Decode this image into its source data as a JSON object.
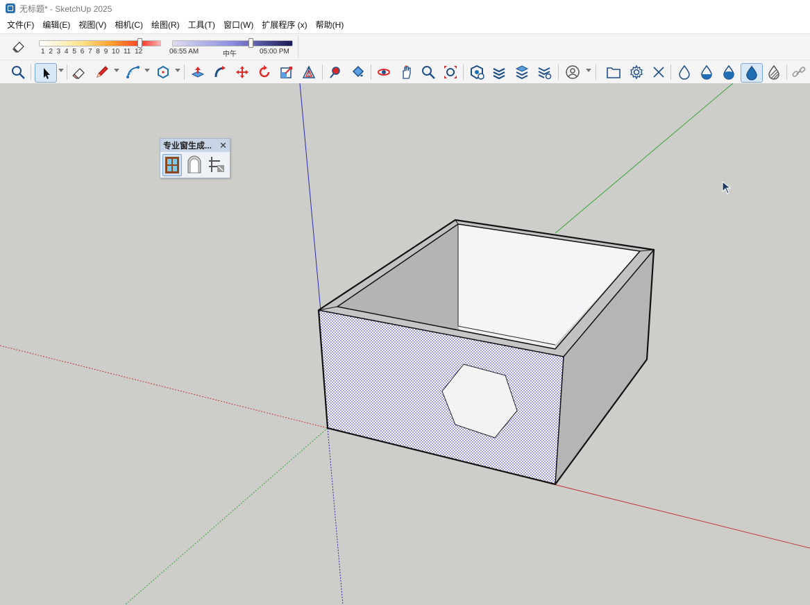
{
  "window": {
    "title": "无标题* - SketchUp 2025",
    "app_icon": "sketchup-logo-icon"
  },
  "menubar": {
    "items": [
      "文件(F)",
      "编辑(E)",
      "视图(V)",
      "相机(C)",
      "绘图(R)",
      "工具(T)",
      "窗口(W)",
      "扩展程序 (x)",
      "帮助(H)"
    ]
  },
  "shadow_toolbar": {
    "toggle_icon": "shadow-toggle-icon",
    "fog_ticks": "1 2 3 4 5 6 7 8 9 10 11 12",
    "time_start": "06:55 AM",
    "time_mid": "中午",
    "time_end": "05:00 PM",
    "colors": {
      "slider_warm": "#ff3a2a",
      "slider_cool": "#1a1a55"
    }
  },
  "main_toolbar": {
    "tools": [
      "search-icon",
      "select-icon",
      "eraser-icon",
      "pencil-icon",
      "arc-icon",
      "polygon-icon",
      "push-pull-icon",
      "follow-me-icon",
      "move-icon",
      "rotate-icon",
      "scale-icon",
      "offset-icon",
      "tape-measure-icon",
      "paint-bucket-icon",
      "orbit-icon",
      "pan-icon",
      "zoom-icon",
      "zoom-extents-icon",
      "component-icon",
      "layers-icon",
      "section-icon",
      "styles-icon",
      "user-icon",
      "folder-icon",
      "settings-icon",
      "close-icon",
      "drop-empty-icon",
      "drop-half-icon",
      "drop-full-icon",
      "drop-active-icon",
      "drop-striped-icon",
      "link-icon"
    ],
    "active_tool": "select-icon",
    "accent": "#1f6fb5"
  },
  "floating_toolbar": {
    "title": "专业窗生成...",
    "close_icon": "close-icon",
    "icons": [
      "window-icon",
      "arch-window-icon",
      "window-edit-icon"
    ]
  },
  "viewport": {
    "background": "#cdcdc9",
    "axis_colors": {
      "red": "#c23a3a",
      "green": "#3aa33a",
      "blue": "#2a2ab0"
    }
  }
}
